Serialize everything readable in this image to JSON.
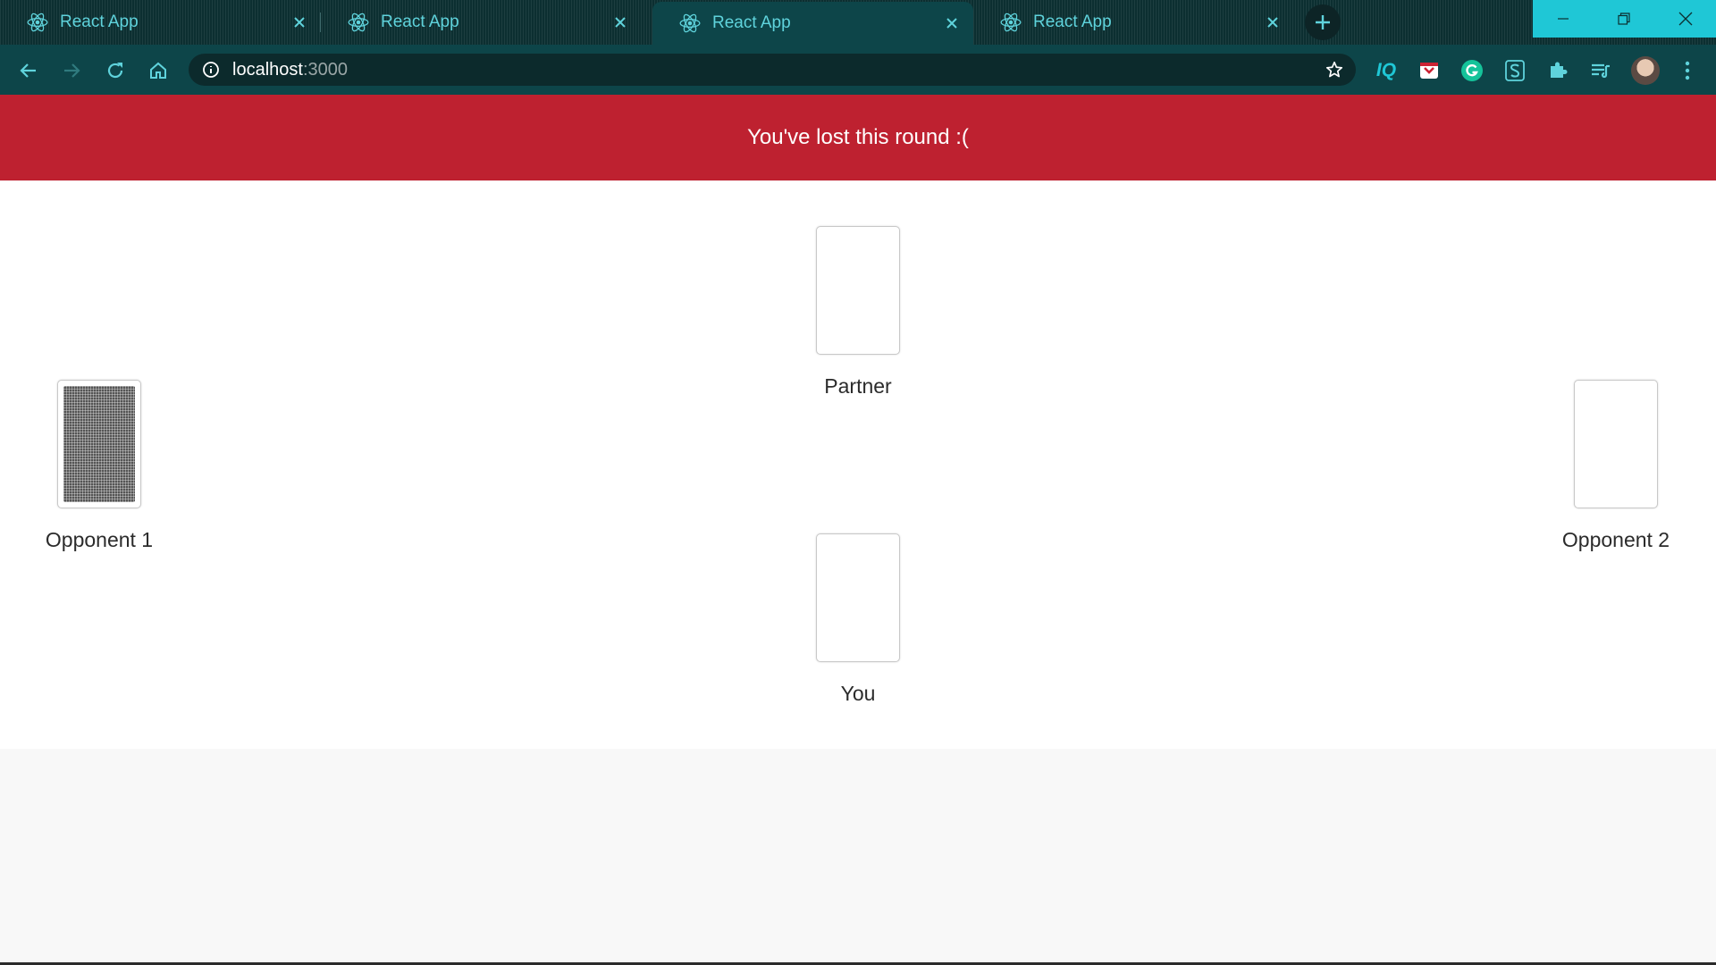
{
  "browser": {
    "tabs": [
      {
        "title": "React App",
        "active": false
      },
      {
        "title": "React App",
        "active": false
      },
      {
        "title": "React App",
        "active": true
      },
      {
        "title": "React App",
        "active": false
      }
    ],
    "address": {
      "host": "localhost",
      "port": ":3000"
    },
    "extensions": [
      "iq-icon",
      "pocket-icon",
      "grammarly-icon",
      "s-extension-icon",
      "puzzle-icon",
      "reading-list-icon"
    ],
    "accent_color": "#1fc7d6",
    "chrome_color": "#0d4549"
  },
  "game": {
    "banner_text": "You've lost this round :(",
    "banner_color": "#be2130",
    "seats": {
      "partner": {
        "label": "Partner",
        "card": "empty"
      },
      "opponent1": {
        "label": "Opponent 1",
        "card": "face-down"
      },
      "opponent2": {
        "label": "Opponent 2",
        "card": "empty"
      },
      "you": {
        "label": "You",
        "card": "empty"
      }
    }
  }
}
